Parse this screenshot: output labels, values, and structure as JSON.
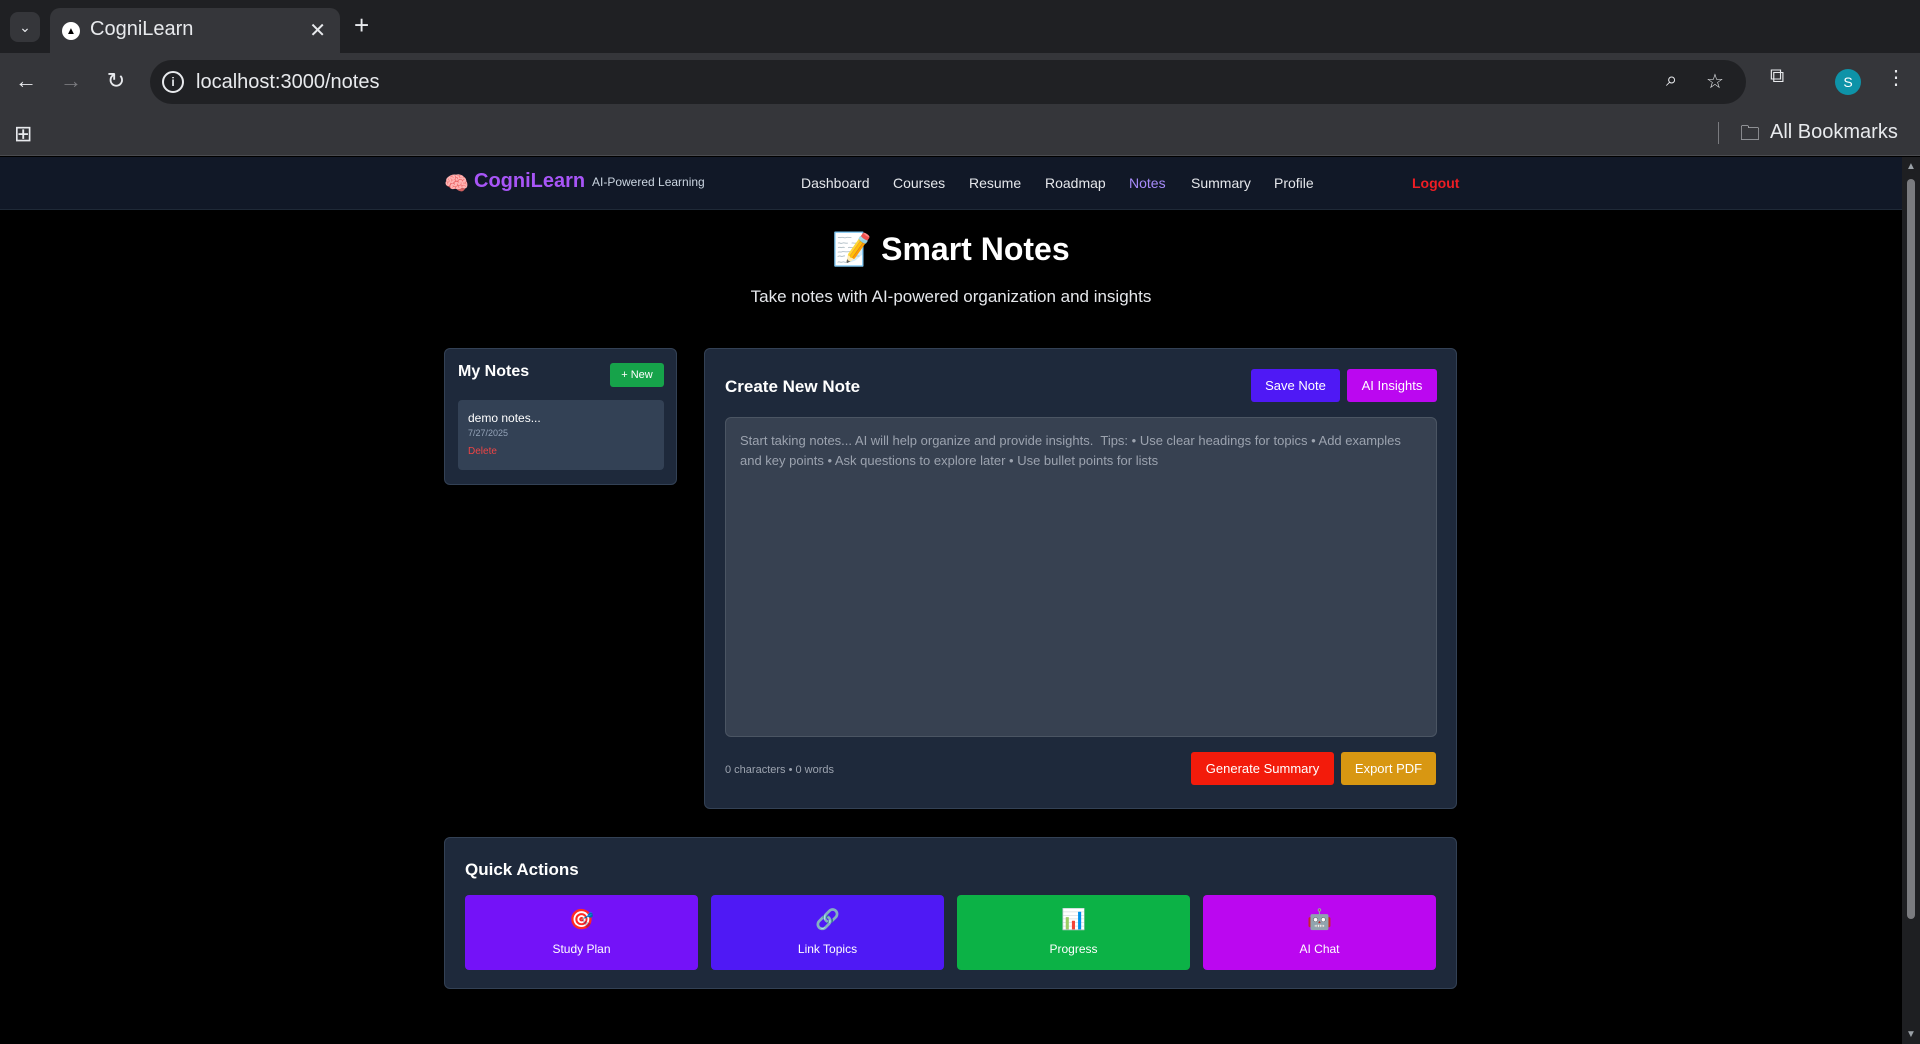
{
  "browser": {
    "tab_title": "CogniLearn",
    "url": "localhost:3000/notes",
    "bookmarks_label": "All Bookmarks",
    "profile_initial": "S"
  },
  "app": {
    "brand_emoji": "🧠",
    "brand_name": "CogniLearn",
    "brand_tagline": "AI-Powered Learning",
    "nav": [
      {
        "label": "Dashboard"
      },
      {
        "label": "Courses"
      },
      {
        "label": "Resume"
      },
      {
        "label": "Roadmap"
      },
      {
        "label": "Notes",
        "active": true
      },
      {
        "label": "Summary"
      },
      {
        "label": "Profile"
      }
    ],
    "logout_label": "Logout"
  },
  "page": {
    "title": "📝 Smart Notes",
    "subtitle": "Take notes with AI-powered organization and insights"
  },
  "notes_panel": {
    "heading": "My Notes",
    "new_label": "+ New",
    "notes": [
      {
        "title": "demo notes...",
        "date": "7/27/2025",
        "delete_label": "Delete"
      }
    ]
  },
  "editor": {
    "heading": "Create New Note",
    "save_label": "Save Note",
    "ai_label": "AI Insights",
    "placeholder": "Start taking notes... AI will help organize and provide insights.  Tips: • Use clear headings for topics • Add examples and key points • Ask questions to explore later • Use bullet points for lists",
    "value": "",
    "counter": "0 characters • 0 words",
    "generate_label": "Generate Summary",
    "export_label": "Export PDF"
  },
  "quick_actions": {
    "heading": "Quick Actions",
    "items": [
      {
        "icon": "🎯",
        "label": "Study Plan",
        "color": "#7412f8"
      },
      {
        "icon": "🔗",
        "label": "Link Topics",
        "color": "#4f19f5"
      },
      {
        "icon": "📊",
        "label": "Progress",
        "color": "#0cb246"
      },
      {
        "icon": "🤖",
        "label": "AI Chat",
        "color": "#bb07f0"
      }
    ]
  },
  "colors": {
    "accent_purple": "#a855f7",
    "logout_red": "#ef1d24",
    "new_green": "#16a34a"
  }
}
